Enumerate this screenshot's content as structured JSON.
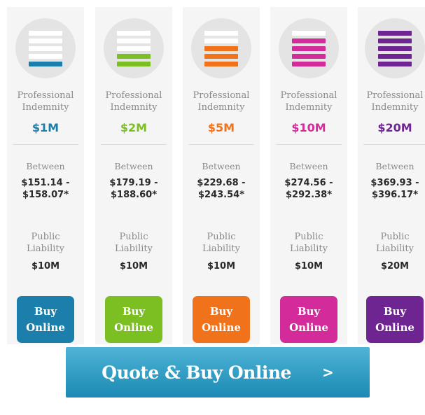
{
  "plans": [
    {
      "pi_label_line1": "Professional",
      "pi_label_line2": "Indemnity",
      "pi_amount": "$1M",
      "between_label": "Between",
      "range_line1": "$151.14 -",
      "range_line2": "$158.07*",
      "pl_label_line1": "Public",
      "pl_label_line2": "Liability",
      "pl_amount": "$10M",
      "buy_line1": "Buy",
      "buy_line2": "Online",
      "color": "#1c7fab",
      "filled_bars": 1,
      "icon": "stack-level-icon"
    },
    {
      "pi_label_line1": "Professional",
      "pi_label_line2": "Indemnity",
      "pi_amount": "$2M",
      "between_label": "Between",
      "range_line1": "$179.19 -",
      "range_line2": "$188.60*",
      "pl_label_line1": "Public",
      "pl_label_line2": "Liability",
      "pl_amount": "$10M",
      "buy_line1": "Buy",
      "buy_line2": "Online",
      "color": "#7cbf23",
      "filled_bars": 2,
      "icon": "stack-level-icon"
    },
    {
      "pi_label_line1": "Professional",
      "pi_label_line2": "Indemnity",
      "pi_amount": "$5M",
      "between_label": "Between",
      "range_line1": "$229.68 -",
      "range_line2": "$243.54*",
      "pl_label_line1": "Public",
      "pl_label_line2": "Liability",
      "pl_amount": "$10M",
      "buy_line1": "Buy",
      "buy_line2": "Online",
      "color": "#f0731b",
      "filled_bars": 3,
      "icon": "stack-level-icon"
    },
    {
      "pi_label_line1": "Professional",
      "pi_label_line2": "Indemnity",
      "pi_amount": "$10M",
      "between_label": "Between",
      "range_line1": "$274.56 -",
      "range_line2": "$292.38*",
      "pl_label_line1": "Public",
      "pl_label_line2": "Liability",
      "pl_amount": "$10M",
      "buy_line1": "Buy",
      "buy_line2": "Online",
      "color": "#d32b9a",
      "filled_bars": 4,
      "icon": "stack-level-icon"
    },
    {
      "pi_label_line1": "Professional",
      "pi_label_line2": "Indemnity",
      "pi_amount": "$20M",
      "between_label": "Between",
      "range_line1": "$369.93 -",
      "range_line2": "$396.17*",
      "pl_label_line1": "Public",
      "pl_label_line2": "Liability",
      "pl_amount": "$20M",
      "buy_line1": "Buy",
      "buy_line2": "Online",
      "color": "#6e2591",
      "filled_bars": 5,
      "icon": "stack-level-icon"
    }
  ],
  "quote_button": {
    "label": "Quote & Buy Online",
    "arrow": ">",
    "arrow_icon": "chevron-right-icon"
  },
  "colors": {
    "card_bg": "#f5f5f5",
    "icon_circle_bg": "#e4e4e4",
    "muted_text": "#8a8a8a",
    "price_text": "#2a2a2a",
    "quote_top": "#4fb3d6",
    "quote_bottom": "#1b8ab4"
  }
}
